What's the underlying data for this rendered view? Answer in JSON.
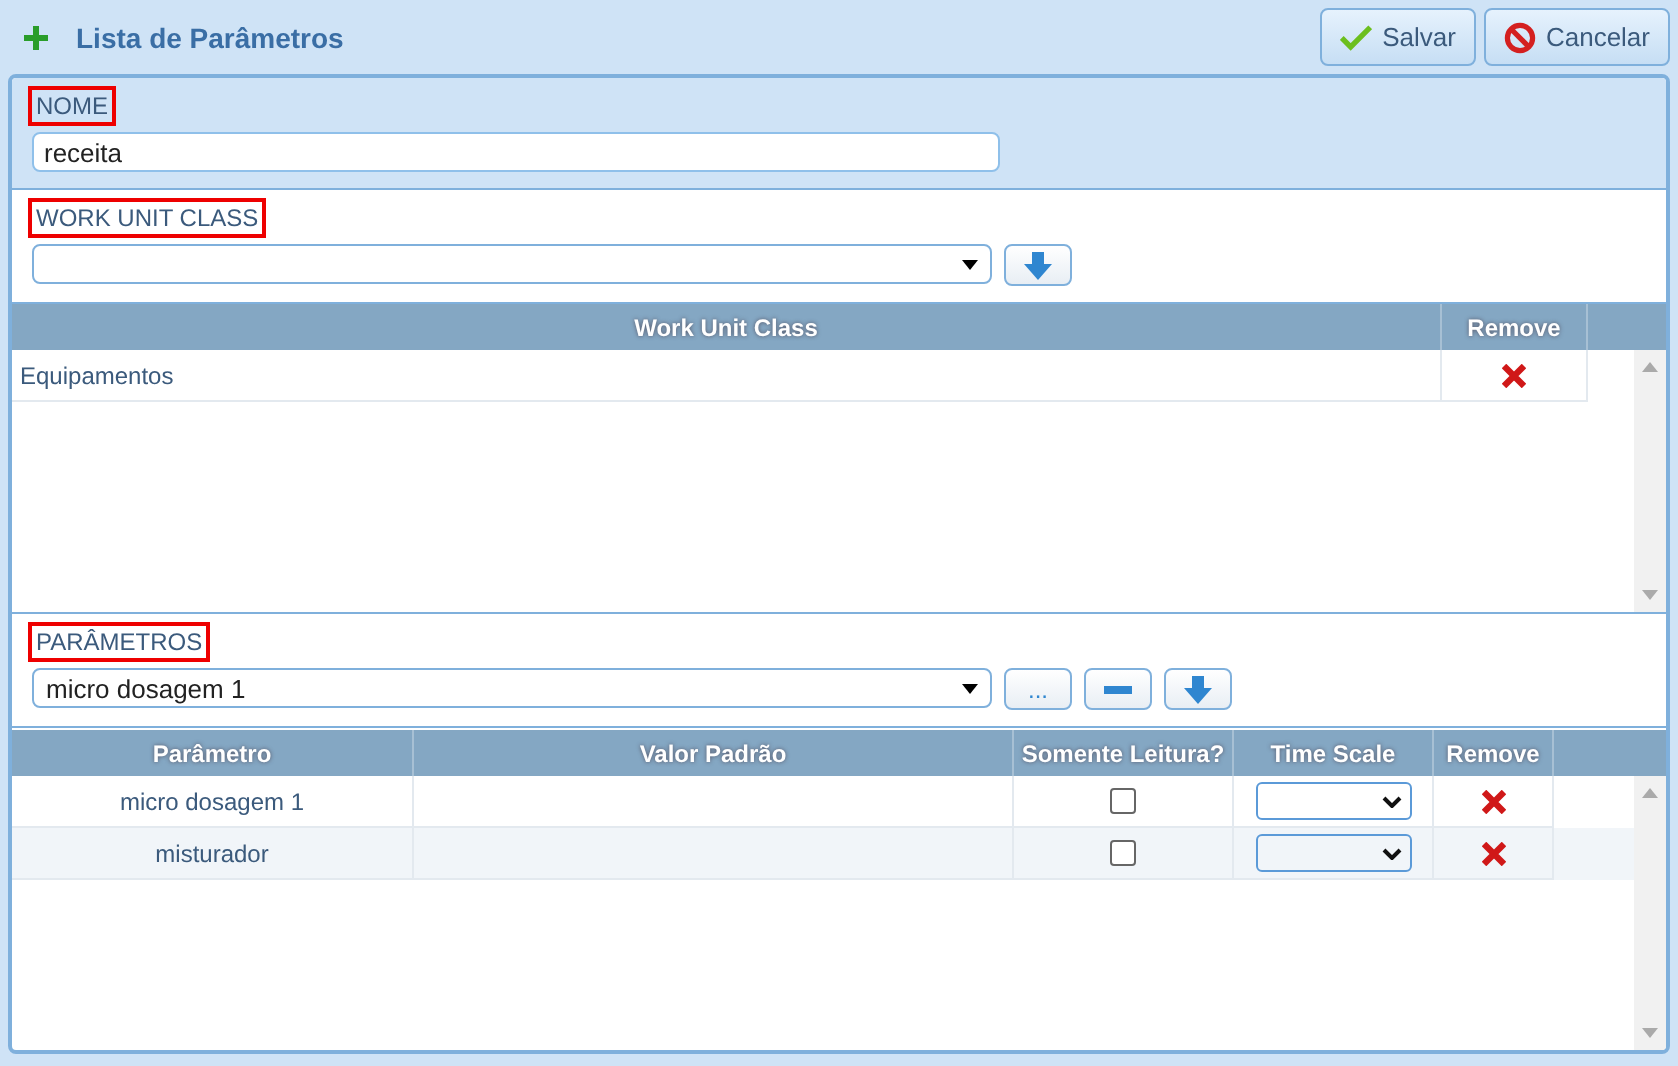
{
  "window": {
    "title": "Lista de Parâmetros"
  },
  "buttons": [
    {
      "kind": "save",
      "label": "Salvar"
    },
    {
      "kind": "cancel",
      "label": "Cancelar"
    }
  ],
  "nome": {
    "label": "NOME",
    "highlighted": true,
    "value": "receita"
  },
  "work_unit": {
    "label": "WORK UNIT CLASS",
    "highlighted": true,
    "columns": [
      "Work Unit Class",
      "Remove"
    ],
    "rows": [
      {
        "name": "Equipamentos"
      }
    ]
  },
  "parametros": {
    "label": "PARÂMETROS",
    "highlighted": true,
    "select_value": "micro dosagem 1",
    "more_button": "...",
    "columns": [
      "Parâmetro",
      "Valor Padrão",
      "Somente Leitura?",
      "Time Scale",
      "Remove"
    ],
    "rows": [
      {
        "name": "micro dosagem 1",
        "read_only": false
      },
      {
        "name": "misturador",
        "read_only": false
      }
    ]
  }
}
